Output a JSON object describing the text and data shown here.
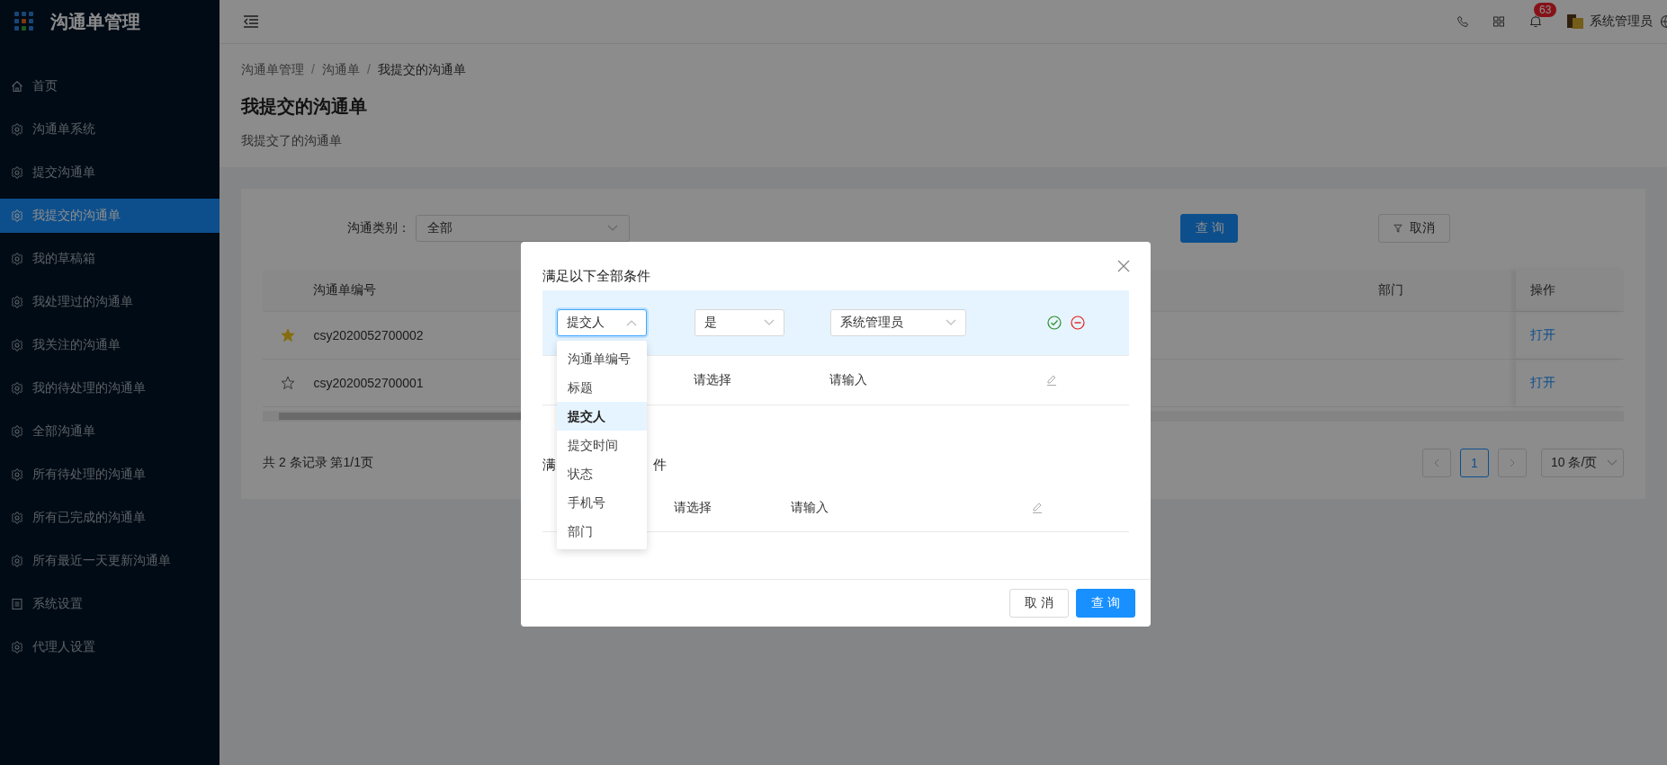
{
  "app": {
    "title": "沟通单管理"
  },
  "sidebar": {
    "items": [
      {
        "label": "首页",
        "kind": "home",
        "selected": false
      },
      {
        "label": "沟通单系统",
        "kind": "gear",
        "selected": false
      },
      {
        "label": "提交沟通单",
        "kind": "gear",
        "selected": false
      },
      {
        "label": "我提交的沟通单",
        "kind": "gear",
        "selected": true
      },
      {
        "label": "我的草稿箱",
        "kind": "gear",
        "selected": false
      },
      {
        "label": "我处理过的沟通单",
        "kind": "gear",
        "selected": false
      },
      {
        "label": "我关注的沟通单",
        "kind": "gear",
        "selected": false
      },
      {
        "label": "我的待处理的沟通单",
        "kind": "gear",
        "selected": false
      },
      {
        "label": "全部沟通单",
        "kind": "gear",
        "selected": false
      },
      {
        "label": "所有待处理的沟通单",
        "kind": "gear",
        "selected": false
      },
      {
        "label": "所有已完成的沟通单",
        "kind": "gear",
        "selected": false
      },
      {
        "label": "所有最近一天更新沟通单",
        "kind": "gear",
        "selected": false
      },
      {
        "label": "系统设置",
        "kind": "list",
        "selected": false
      },
      {
        "label": "代理人设置",
        "kind": "gear",
        "selected": false
      }
    ]
  },
  "header": {
    "notifications": "63",
    "user": "系统管理员"
  },
  "breadcrumb": [
    {
      "kind": "link",
      "text": "沟通单管理"
    },
    {
      "kind": "separator",
      "text": "/"
    },
    {
      "kind": "link",
      "text": "沟通单"
    },
    {
      "kind": "separator",
      "text": "/"
    },
    {
      "kind": "current",
      "text": "我提交的沟通单"
    }
  ],
  "page": {
    "title": "我提交的沟通单",
    "subtitle": "我提交了的沟通单"
  },
  "filter": {
    "label": "沟通类别：",
    "value": "全部",
    "search_button": "查 询",
    "cancel_button": "取消"
  },
  "table": {
    "columns": [
      "沟通单编号",
      "部门",
      "操作"
    ],
    "rows": [
      {
        "starred": true,
        "id": "csy2020052700002",
        "action": "打开"
      },
      {
        "starred": false,
        "id": "csy2020052700001",
        "action": "打开"
      }
    ]
  },
  "pagination": {
    "summary": "共 2 条记录 第1/1页",
    "pages": [
      {
        "label": "1",
        "selected": true
      }
    ],
    "page_size": "10 条/页"
  },
  "modal": {
    "groups": [
      {
        "title": "满足以下全部条件",
        "rows": [
          {
            "kind": "editing",
            "field": "提交人",
            "operator": "是",
            "value": "系统管理员",
            "open": true
          },
          {
            "kind": "display",
            "operator": "请选择",
            "value": "请输入"
          }
        ]
      },
      {
        "title_start": "满",
        "title_end": "件",
        "rows": [
          {
            "kind": "display",
            "operator": "请选择",
            "value": "请输入"
          }
        ]
      }
    ],
    "dropdown": {
      "options": [
        {
          "label": "沟通单编号",
          "selected": false
        },
        {
          "label": "标题",
          "selected": false
        },
        {
          "label": "提交人",
          "selected": true
        },
        {
          "label": "提交时间",
          "selected": false
        },
        {
          "label": "状态",
          "selected": false
        },
        {
          "label": "手机号",
          "selected": false
        },
        {
          "label": "部门",
          "selected": false
        }
      ]
    },
    "buttons": {
      "cancel": "取 消",
      "ok": "查 询"
    }
  }
}
